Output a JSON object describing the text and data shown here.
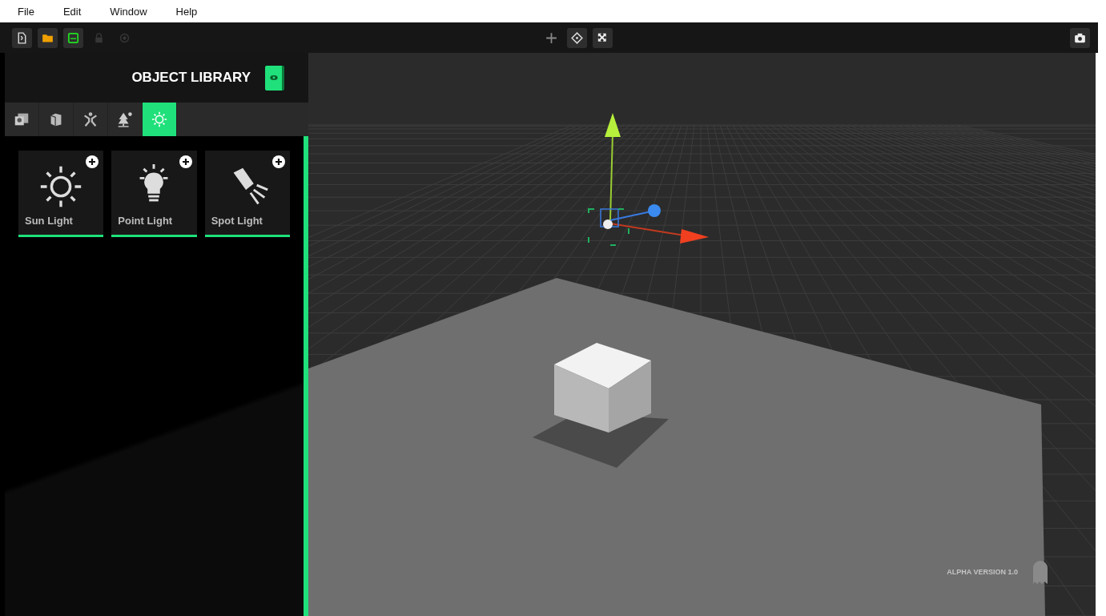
{
  "menu": [
    {
      "label": "File"
    },
    {
      "label": "Edit"
    },
    {
      "label": "Window"
    },
    {
      "label": "Help"
    }
  ],
  "toolbar": {
    "file_tools": [
      {
        "kind": "new",
        "disabled": false
      },
      {
        "kind": "open",
        "disabled": false
      },
      {
        "kind": "save",
        "disabled": false
      },
      {
        "kind": "lock",
        "disabled": true
      },
      {
        "kind": "record",
        "disabled": true
      }
    ],
    "transform_tools": [
      {
        "kind": "move",
        "selected": false
      },
      {
        "kind": "rotate",
        "selected": true
      },
      {
        "kind": "scale",
        "selected": true
      }
    ],
    "snapshot": {
      "kind": "camera"
    }
  },
  "panel": {
    "title": "OBJECT LIBRARY",
    "tabs": [
      {
        "kind": "image",
        "selected": false
      },
      {
        "kind": "box",
        "selected": false
      },
      {
        "kind": "figure",
        "selected": false
      },
      {
        "kind": "tree",
        "selected": false
      },
      {
        "kind": "light",
        "selected": true
      }
    ],
    "items": [
      {
        "label": "Sun Light",
        "kind": "sun"
      },
      {
        "label": "Point Light",
        "kind": "bulb"
      },
      {
        "label": "Spot Light",
        "kind": "spot"
      }
    ]
  },
  "viewport": {
    "version": "ALPHA VERSION 1.0"
  }
}
